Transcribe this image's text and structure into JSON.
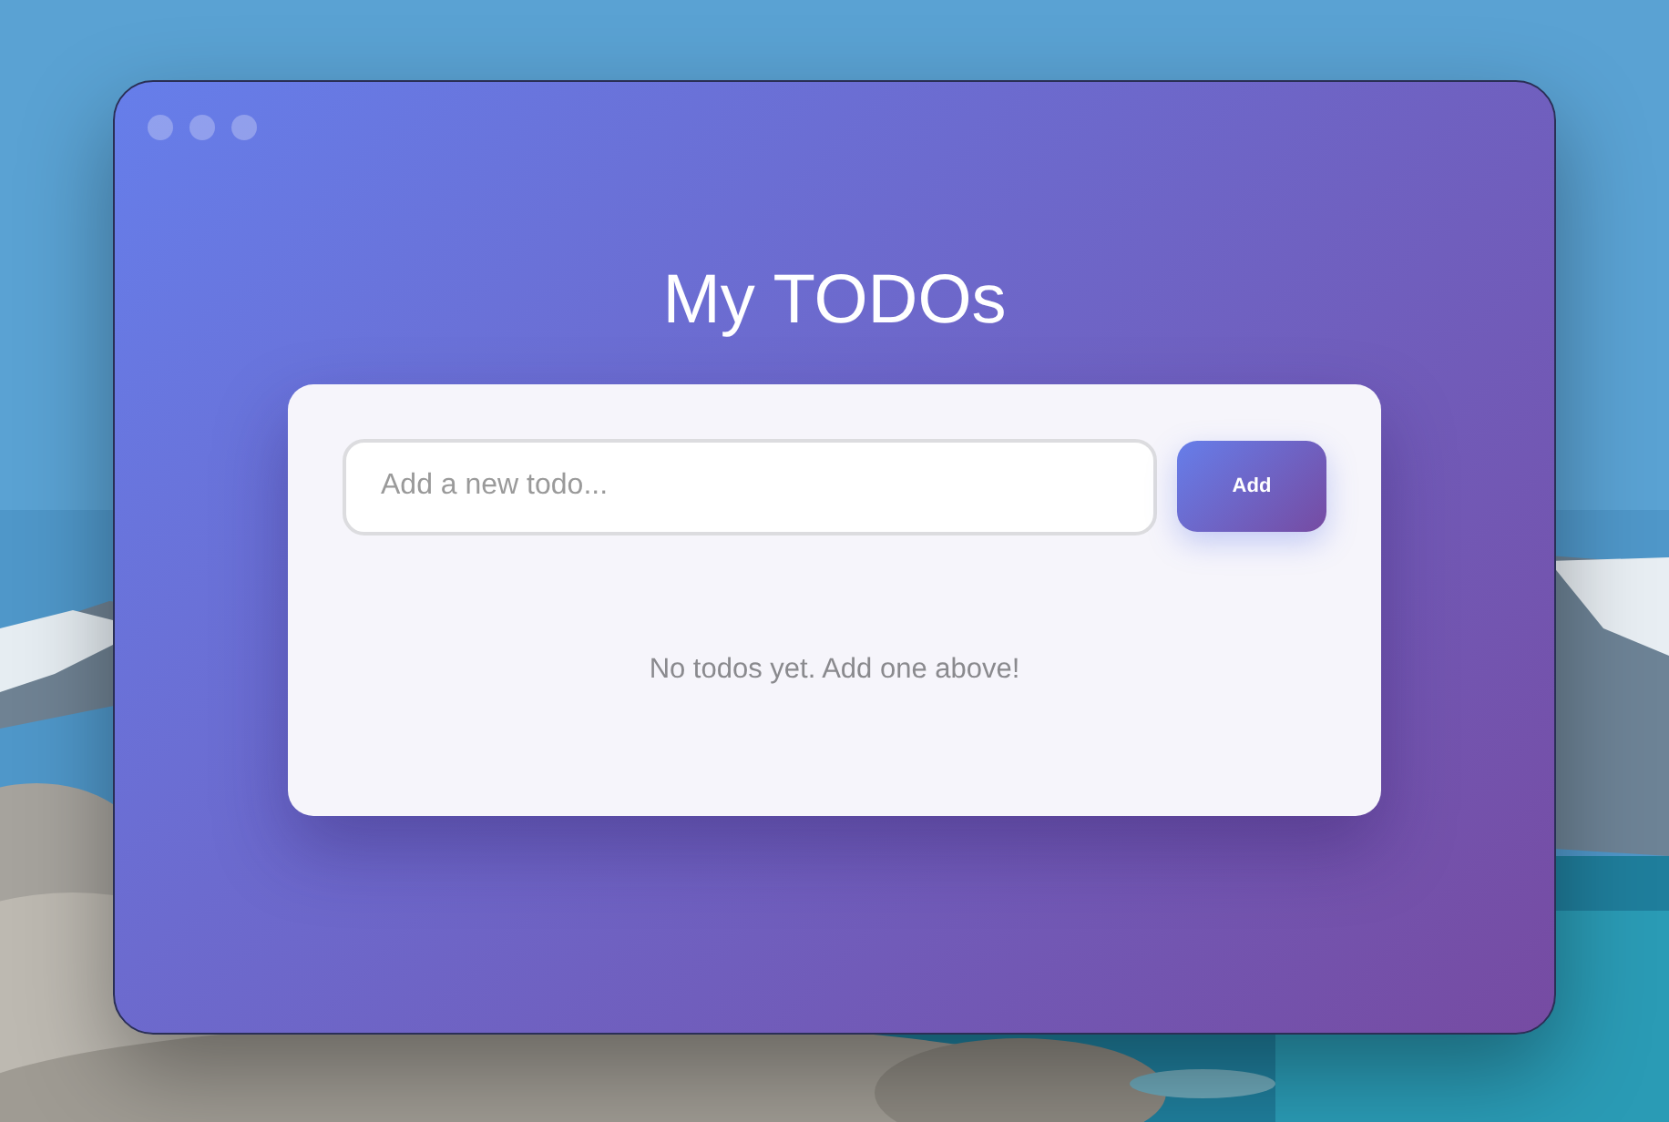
{
  "window": {
    "title": "My TODOs"
  },
  "new_todo": {
    "placeholder": "Add a new todo..."
  },
  "add_button": {
    "label": "Add"
  },
  "empty_message": "No todos yet. Add one above!"
}
